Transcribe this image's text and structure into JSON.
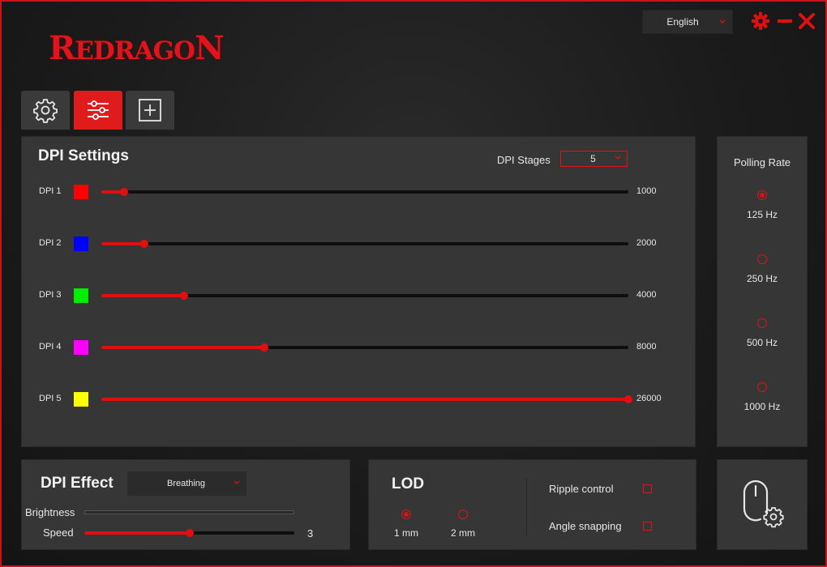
{
  "app": {
    "logo_text": "REDRAGON",
    "language": "English",
    "icons": {
      "settings": "gear-icon",
      "minimize": "minimize-icon",
      "close": "close-icon"
    },
    "accent_color": "#e01010"
  },
  "tabs": [
    {
      "name": "tab-general",
      "icon": "gear-icon",
      "active": false
    },
    {
      "name": "tab-adjust",
      "icon": "sliders-icon",
      "active": true
    },
    {
      "name": "tab-add",
      "icon": "plus-square-icon",
      "active": false
    }
  ],
  "dpi_settings": {
    "title": "DPI Settings",
    "stages_label": "DPI Stages",
    "stages_value": "5",
    "levels": [
      {
        "label": "DPI 1",
        "color": "#ff0000",
        "value": "1000",
        "fraction": 0.043
      },
      {
        "label": "DPI 2",
        "color": "#0000ff",
        "value": "2000",
        "fraction": 0.082
      },
      {
        "label": "DPI 3",
        "color": "#00ee00",
        "value": "4000",
        "fraction": 0.157
      },
      {
        "label": "DPI 4",
        "color": "#ff00ff",
        "value": "8000",
        "fraction": 0.309
      },
      {
        "label": "DPI 5",
        "color": "#ffff00",
        "value": "26000",
        "fraction": 1.0
      }
    ]
  },
  "polling_rate": {
    "title": "Polling Rate",
    "options": [
      {
        "label": "125 Hz",
        "checked": true
      },
      {
        "label": "250 Hz",
        "checked": false
      },
      {
        "label": "500 Hz",
        "checked": false
      },
      {
        "label": "1000 Hz",
        "checked": false
      }
    ]
  },
  "dpi_effect": {
    "title": "DPI Effect",
    "mode": "Breathing",
    "brightness_label": "Brightness",
    "brightness_fraction": 0,
    "speed_label": "Speed",
    "speed_value": "3",
    "speed_fraction": 0.5
  },
  "lod": {
    "title": "LOD",
    "options": [
      {
        "label": "1 mm",
        "checked": true
      },
      {
        "label": "2 mm",
        "checked": false
      }
    ],
    "ripple_label": "Ripple control",
    "ripple_checked": false,
    "angle_label": "Angle snapping",
    "angle_checked": false
  },
  "mouse_settings_icon": "mouse-settings-icon"
}
